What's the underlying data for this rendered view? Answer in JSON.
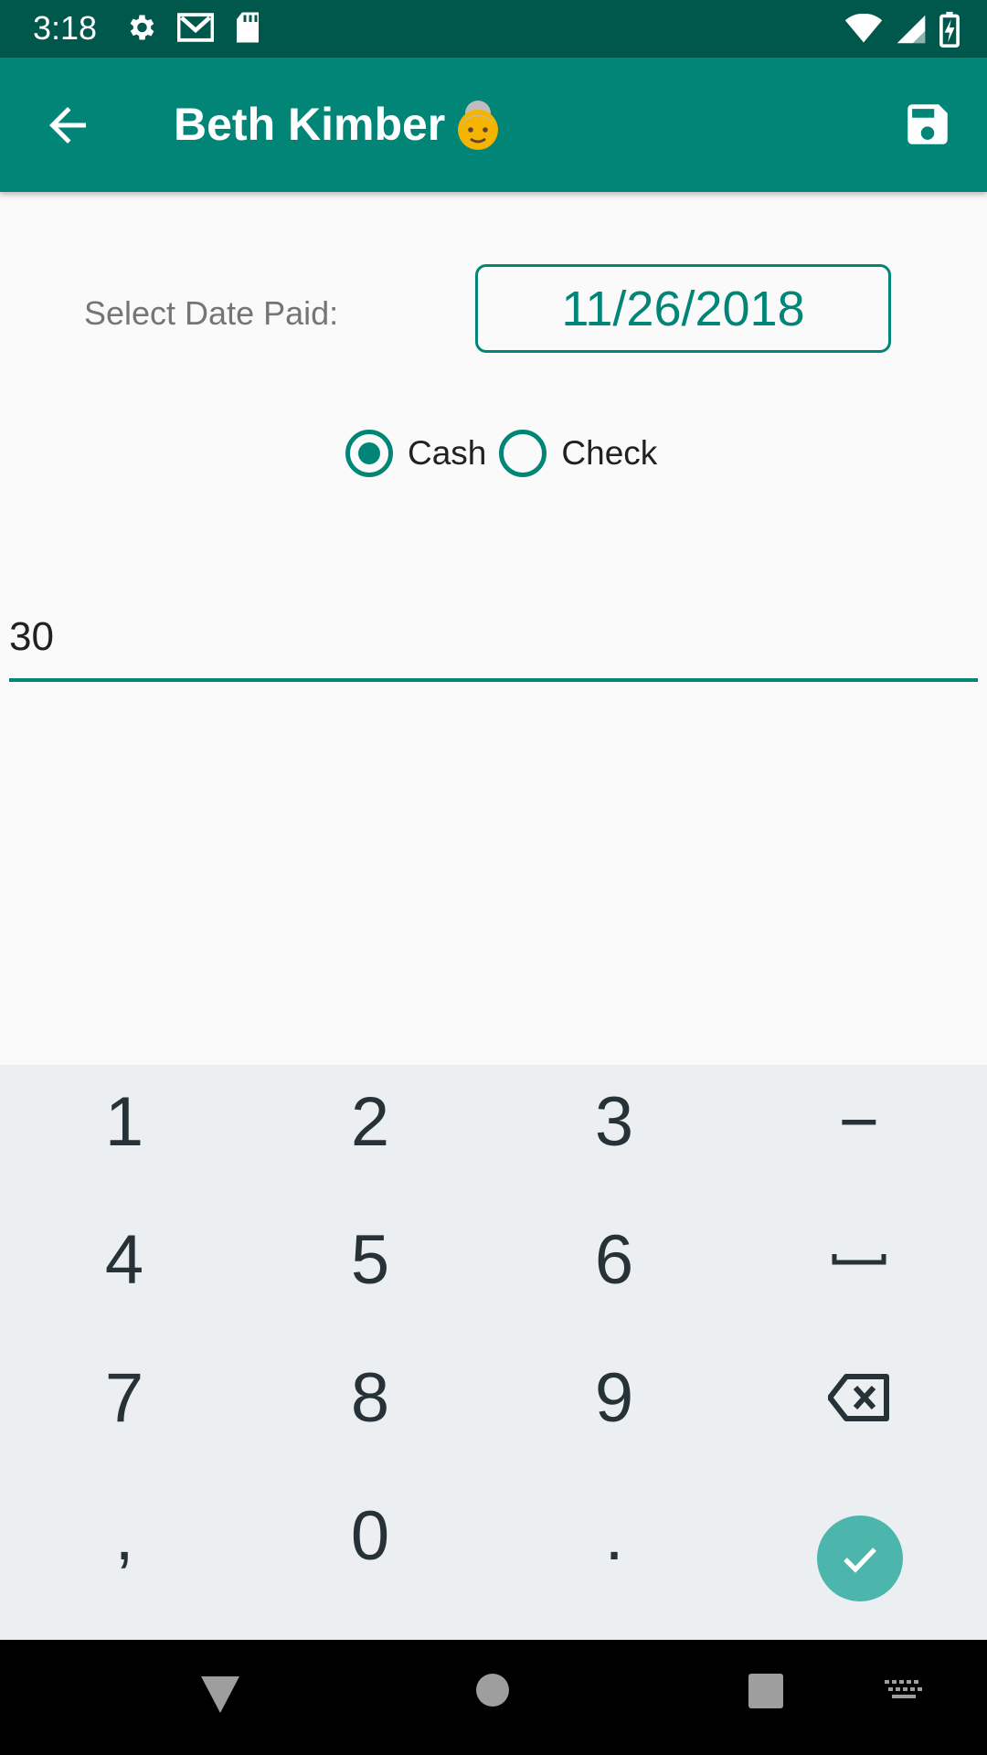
{
  "status_bar": {
    "time": "3:18",
    "icons_left": [
      "settings-icon",
      "gmail-icon",
      "sd-card-icon"
    ],
    "icons_right": [
      "wifi-icon",
      "signal-icon",
      "battery-charging-icon"
    ]
  },
  "app_bar": {
    "title": "Beth Kimber",
    "back_icon": "arrow-back-icon",
    "save_icon": "save-icon",
    "color": "#008577"
  },
  "form": {
    "date_label": "Select Date Paid:",
    "date_value": "11/26/2018",
    "payment_options": [
      {
        "label": "Cash",
        "checked": true
      },
      {
        "label": "Check",
        "checked": false
      }
    ],
    "amount_value": "30"
  },
  "keyboard": {
    "rows": [
      [
        "1",
        "2",
        "3",
        "−"
      ],
      [
        "4",
        "5",
        "6",
        "space"
      ],
      [
        "7",
        "8",
        "9",
        "backspace"
      ],
      [
        ",",
        "0",
        ".",
        "enter"
      ]
    ],
    "enter_color": "#4db6ac"
  },
  "nav_bar": {
    "buttons": [
      "back-triangle-icon",
      "home-circle-icon",
      "recents-square-icon",
      "keyboard-switch-icon"
    ]
  }
}
